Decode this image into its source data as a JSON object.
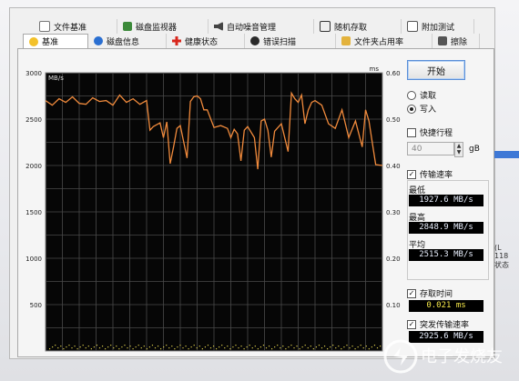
{
  "tabs_row1": [
    {
      "label": "文件基准",
      "icon": "document-icon"
    },
    {
      "label": "磁盘监视器",
      "icon": "disk-monitor-icon"
    },
    {
      "label": "自动噪音管理",
      "icon": "speaker-icon"
    },
    {
      "label": "随机存取",
      "icon": "checkbox-icon"
    },
    {
      "label": "附加测试",
      "icon": "note-icon"
    }
  ],
  "tabs_row2": [
    {
      "label": "基准",
      "icon": "bulb-icon",
      "active": true
    },
    {
      "label": "磁盘信息",
      "icon": "info-icon"
    },
    {
      "label": "健康状态",
      "icon": "health-cross-icon"
    },
    {
      "label": "错误扫描",
      "icon": "magnifier-icon"
    },
    {
      "label": "文件夹占用率",
      "icon": "folder-icon"
    },
    {
      "label": "擦除",
      "icon": "trash-icon"
    }
  ],
  "controls": {
    "start_label": "开始",
    "read_label": "读取",
    "write_label": "写入",
    "quick_stroke_label": "快捷行程",
    "quick_stroke_value": "40",
    "quick_stroke_unit": "gB",
    "transfer_rate_label": "传输速率",
    "min_label": "最低",
    "min_value": "1927.6 MB/s",
    "max_label": "最高",
    "max_value": "2848.9 MB/s",
    "avg_label": "平均",
    "avg_value": "2515.3 MB/s",
    "access_time_label": "存取时间",
    "access_time_value": "0.021 ms",
    "burst_rate_label": "突发传输速率",
    "burst_rate_value": "2925.6 MB/s"
  },
  "right_peek": {
    "line1": "(L",
    "line2": "118",
    "line3": "状态"
  },
  "watermark_text": "电子发烧友",
  "chart_data": {
    "type": "line",
    "left_axis_unit": "MB/s",
    "right_axis_unit": "ms",
    "left_ticks": [
      500,
      1000,
      1500,
      2000,
      2500,
      3000
    ],
    "right_ticks": [
      "0.10",
      "0.20",
      "0.30",
      "0.40",
      "0.50",
      "0.60"
    ],
    "ylim": [
      0,
      3000
    ],
    "y2lim": [
      0,
      0.6
    ],
    "grid": true,
    "series": [
      {
        "color": "#f08a3c",
        "x": [
          0,
          2,
          4,
          6,
          8,
          10,
          12,
          14,
          16,
          18,
          20,
          22,
          24,
          26,
          28,
          30,
          31,
          32,
          34,
          35,
          36,
          37,
          38,
          39,
          40,
          42,
          43,
          44,
          45,
          46,
          47,
          48,
          50,
          52,
          54,
          55,
          56,
          57,
          58,
          59,
          60,
          62,
          63,
          64,
          65,
          66,
          67,
          68,
          70,
          72,
          73,
          74,
          75,
          76,
          77,
          78,
          79,
          80,
          82,
          84,
          86,
          88,
          90,
          92,
          94,
          95,
          96,
          98,
          100
        ],
        "values": [
          2700,
          2650,
          2720,
          2680,
          2740,
          2670,
          2660,
          2730,
          2690,
          2700,
          2650,
          2760,
          2680,
          2720,
          2660,
          2700,
          2380,
          2420,
          2460,
          2300,
          2470,
          2020,
          2200,
          2400,
          2430,
          2080,
          2690,
          2740,
          2750,
          2720,
          2600,
          2600,
          2410,
          2430,
          2400,
          2300,
          2390,
          2340,
          2050,
          2380,
          2420,
          2300,
          1960,
          2480,
          2500,
          2380,
          2090,
          2370,
          2450,
          2150,
          2780,
          2720,
          2680,
          2760,
          2450,
          2600,
          2680,
          2700,
          2650,
          2450,
          2400,
          2600,
          2300,
          2480,
          2200,
          2600,
          2480,
          2010,
          2000
        ]
      }
    ]
  }
}
